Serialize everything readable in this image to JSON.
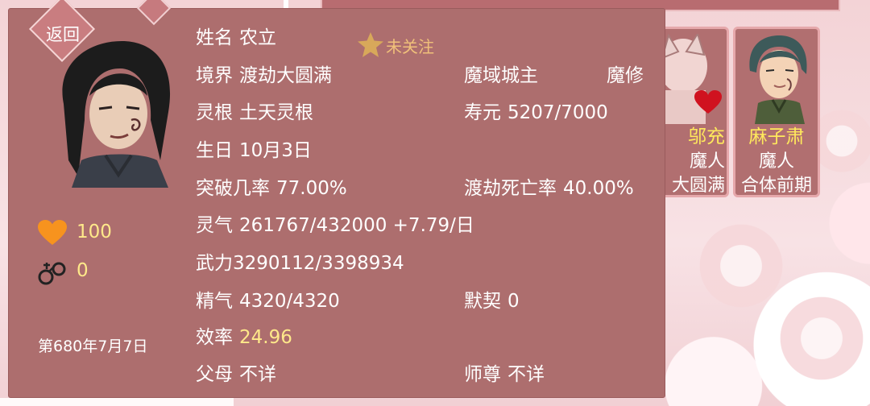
{
  "back_label": "返回",
  "profile": {
    "name_label": "姓名",
    "name": "农立",
    "follow_label": "未关注",
    "realm_label": "境界",
    "realm": "渡劫大圆满",
    "title": "魔域城主",
    "sect": "魔修",
    "root_label": "灵根",
    "root": "土天灵根",
    "lifespan_label": "寿元",
    "lifespan": "5207/7000",
    "birthday_label": "生日",
    "birthday": "10月3日",
    "breakthrough_label": "突破几率",
    "breakthrough": "77.00%",
    "tribulation_death_label": "渡劫死亡率",
    "tribulation_death": "40.00%",
    "qi_label": "灵气",
    "qi": "261767/432000 +7.79/日",
    "force_label": "武力",
    "force": "3290112/3398934",
    "essence_label": "精气",
    "essence": "4320/4320",
    "rapport_label": "默契",
    "rapport": "0",
    "efficiency_label": "效率",
    "efficiency": "24.96",
    "parents_label": "父母",
    "parents": "不详",
    "master_label": "师尊",
    "master": "不详"
  },
  "stats": {
    "affection": "100",
    "captivity": "0"
  },
  "game_date": "第680年7月7日",
  "cards": [
    {
      "name": "邬充",
      "race": "魔人",
      "realm": "大圆满"
    },
    {
      "name": "麻子肃",
      "race": "魔人",
      "realm": "合体前期"
    }
  ],
  "colors": {
    "panel": "#ad6e6e",
    "highlight_yellow": "#ffe98a",
    "name_yellow": "#ffe95c",
    "follow_gold": "#f0c07a",
    "heart_orange": "#f7931e",
    "heart_red": "#d0121f"
  },
  "icons": {
    "follow": "star-icon",
    "affection": "heart-icon",
    "captivity": "handcuffs-icon"
  }
}
